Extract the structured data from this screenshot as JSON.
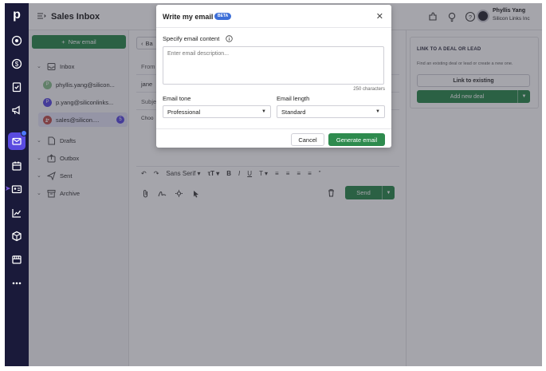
{
  "app": {
    "logo": "p",
    "header_title": "Sales Inbox"
  },
  "user": {
    "name": "Phyllis Yang",
    "company": "Silicon Links Inc"
  },
  "sidebar": {
    "new_email_label": "New email",
    "inbox_label": "Inbox",
    "accounts": [
      {
        "label": "phyllis.yang@silicon...",
        "initial": "P",
        "color": "#8bbf8d"
      },
      {
        "label": "p.yang@siliconlinks...",
        "initial": "P",
        "color": "#5a4be0"
      },
      {
        "label": "sales@silicon....",
        "initial": "",
        "color": "#c0524f",
        "badge": "5"
      }
    ],
    "folders": [
      "Drafts",
      "Outbox",
      "Sent",
      "Archive"
    ]
  },
  "main": {
    "back_label": "Ba",
    "from_label": "From",
    "to_value": "jane",
    "subject_label": "Subje",
    "chip_label": "Choo",
    "toolbar": {
      "font": "Sans Serif"
    },
    "send_label": "Send"
  },
  "right_panel": {
    "title": "LINK TO A DEAL OR LEAD",
    "description": "Find an existing deal or lead or create a new one.",
    "link_existing_label": "Link to existing",
    "add_new_deal_label": "Add new deal"
  },
  "modal": {
    "title": "Write my email",
    "beta": "BETA",
    "content_label": "Specify email content",
    "content_placeholder": "Enter email description...",
    "chars_remaining": "250 characters",
    "tone_label": "Email tone",
    "tone_value": "Professional",
    "length_label": "Email length",
    "length_value": "Standard",
    "cancel_label": "Cancel",
    "generate_label": "Generate email"
  },
  "colors": {
    "rail": "#1a1a3a",
    "accent_green": "#2e8b4e",
    "active_purple": "#5a4be0",
    "beta_blue": "#3d6fd8"
  },
  "icons": [
    "rail-target-icon",
    "rail-dollar-icon",
    "rail-tasks-icon",
    "rail-megaphone-icon",
    "rail-mail-icon",
    "rail-calendar-icon",
    "rail-contacts-icon",
    "rail-chart-icon",
    "rail-box-icon",
    "rail-store-icon",
    "rail-more-icon",
    "menu-icon",
    "extensions-icon",
    "lightbulb-icon",
    "help-icon"
  ]
}
